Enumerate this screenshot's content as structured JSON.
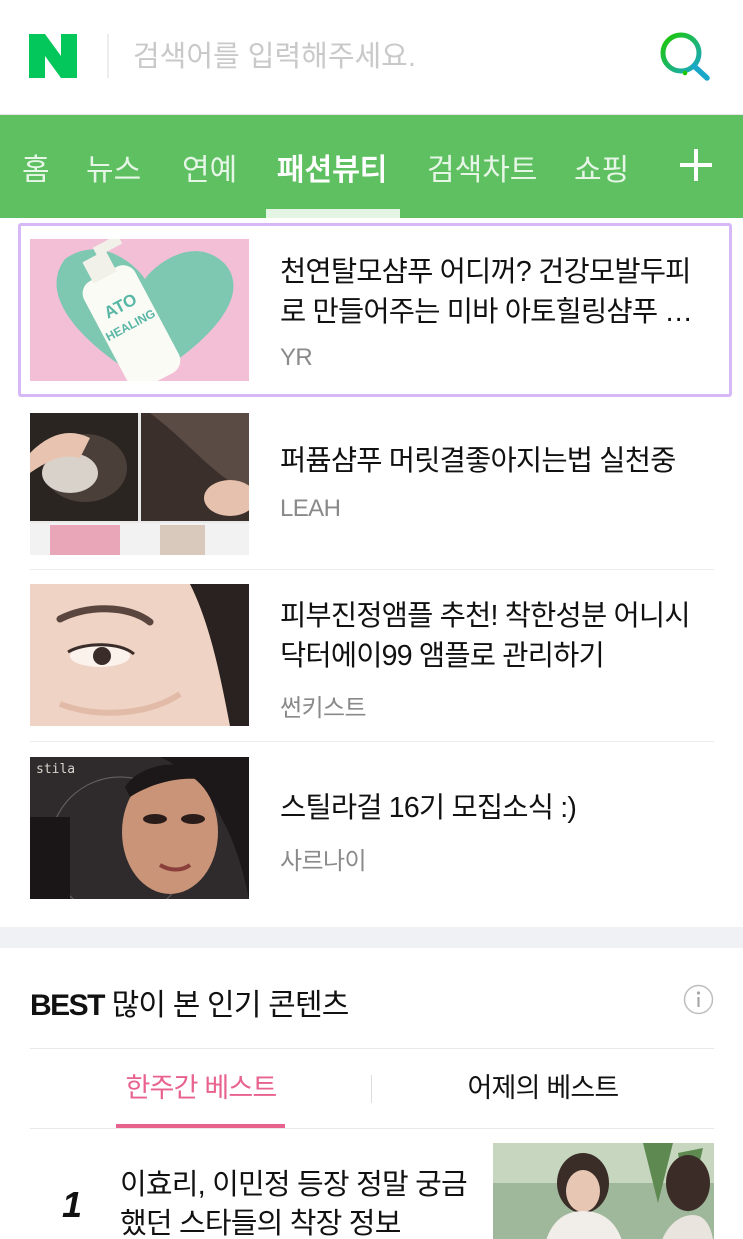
{
  "header": {
    "search_placeholder": "검색어를 입력해주세요.",
    "brand_color": "#03c75a"
  },
  "nav": {
    "tabs": [
      {
        "label": "홈"
      },
      {
        "label": "뉴스"
      },
      {
        "label": "연예"
      },
      {
        "label": "패션뷰티",
        "active": true
      },
      {
        "label": "검색차트"
      },
      {
        "label": "쇼핑"
      }
    ],
    "more_icon": "plus-icon",
    "bg_color": "#5ec061"
  },
  "articles": [
    {
      "title_line1": "천연탈모샴푸 어디꺼? 건강모발두피",
      "title_line2": "로 만들어주는 미바 아토힐링샴푸 …",
      "source": "YR",
      "selected": true
    },
    {
      "title_line1": "퍼퓸샴푸 머릿결좋아지는법 실천중",
      "source": "LEAH"
    },
    {
      "title_line1": "피부진정앰플 추천! 착한성분 어니시",
      "title_line2": "닥터에이99 앰플로 관리하기",
      "source": "썬키스트"
    },
    {
      "title_line1": "스틸라걸 16기 모집소식 :)",
      "source": "사르나이"
    }
  ],
  "best": {
    "tag": "BEST",
    "heading": "많이 본 인기 콘텐츠",
    "tabs": [
      {
        "label": "한주간 베스트",
        "active": true
      },
      {
        "label": "어제의 베스트"
      }
    ],
    "items": [
      {
        "rank": "1",
        "title_line1": "이효리, 이민정 등장 정말 궁금",
        "title_line2": "했던 스타들의 착장 정보"
      }
    ],
    "accent_color": "#e8628e"
  }
}
